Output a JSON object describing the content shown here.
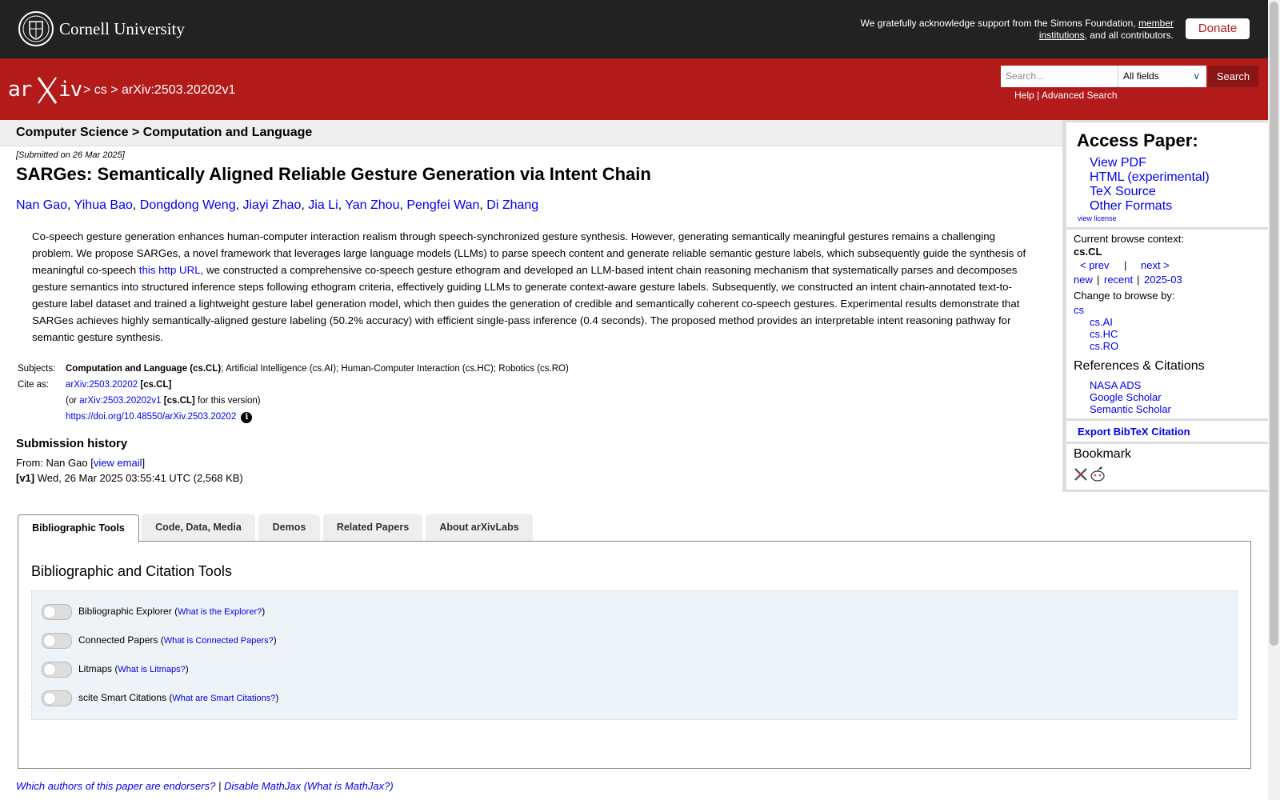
{
  "topbar": {
    "institution": "Cornell University",
    "support_prefix": "We gratefully acknowledge support from the Simons Foundation,",
    "support_link": "member institutions",
    "support_suffix": ", and all contributors.",
    "donate": "Donate"
  },
  "header": {
    "breadcrumb": "> cs > arXiv:2503.20202v1",
    "search_placeholder": "Search...",
    "search_field": "All fields",
    "search_button": "Search",
    "help": "Help",
    "sep": "|",
    "advanced": "Advanced Search"
  },
  "subheader": "Computer Science > Computation and Language",
  "paper": {
    "submitted": "[Submitted on 26 Mar 2025]",
    "title": "SARGes: Semantically Aligned Reliable Gesture Generation via Intent Chain",
    "authors": [
      "Nan Gao",
      "Yihua Bao",
      "Dongdong Weng",
      "Jiayi Zhao",
      "Jia Li",
      "Yan Zhou",
      "Pengfei Wan",
      "Di Zhang"
    ],
    "abstract_1": "Co-speech gesture generation enhances human-computer interaction realism through speech-synchronized gesture synthesis. However, generating semantically meaningful gestures remains a challenging problem. We propose SARGes, a novel framework that leverages large language models (LLMs) to parse speech content and generate reliable semantic gesture labels, which subsequently guide the synthesis of meaningful co-speech",
    "abstract_link": "this http URL",
    "abstract_2": ", we constructed a comprehensive co-speech gesture ethogram and developed an LLM-based intent chain reasoning mechanism that systematically parses and decomposes gesture semantics into structured inference steps following ethogram criteria, effectively guiding LLMs to generate context-aware gesture labels. Subsequently, we constructed an intent chain-annotated text-to-gesture label dataset and trained a lightweight gesture label generation model, which then guides the generation of credible and semantically coherent co-speech gestures. Experimental results demonstrate that SARGes achieves highly semantically-aligned gesture labeling (50.2% accuracy) with efficient single-pass inference (0.4 seconds). The proposed method provides an interpretable intent reasoning pathway for semantic gesture synthesis.",
    "subjects_label": "Subjects:",
    "subjects_primary": "Computation and Language (cs.CL)",
    "subjects_rest": "; Artificial Intelligence (cs.AI); Human-Computer Interaction (cs.HC); Robotics (cs.RO)",
    "cite_label": "Cite as:",
    "cite_id": "arXiv:2503.20202",
    "cite_cat": "[cs.CL]",
    "cite_or": "(or",
    "cite_version": "arXiv:2503.20202v1",
    "cite_cat2": "[cs.CL]",
    "cite_suffix": "for this version)",
    "doi": "https://doi.org/10.48550/arXiv.2503.20202",
    "history_title": "Submission history",
    "from": "From: Nan Gao [",
    "view_email": "view email",
    "from_close": "]",
    "v1_tag": "[v1]",
    "v1_text": "Wed, 26 Mar 2025 03:55:41 UTC (2,568 KB)"
  },
  "sidebar": {
    "access_title": "Access Paper:",
    "access_links": [
      "View PDF",
      "HTML (experimental)",
      "TeX Source",
      "Other Formats"
    ],
    "view_license": "view license",
    "browse_context": "Current browse context:",
    "context": "cs.CL",
    "prev": "< prev",
    "bar": "|",
    "next": "next >",
    "new": "new",
    "recent": "recent",
    "month": "2025-03",
    "change_browse": "Change to browse by:",
    "browse_cats": [
      "cs",
      "cs.AI",
      "cs.HC",
      "cs.RO"
    ],
    "refs_title": "References & Citations",
    "refs_links": [
      "NASA ADS",
      "Google Scholar",
      "Semantic Scholar"
    ],
    "export": "Export BibTeX Citation",
    "bookmark": "Bookmark"
  },
  "tabs": [
    "Bibliographic Tools",
    "Code, Data, Media",
    "Demos",
    "Related Papers",
    "About arXivLabs"
  ],
  "tools": {
    "title": "Bibliographic and Citation Tools",
    "items": [
      {
        "label": "Bibliographic Explorer",
        "link": "What is the Explorer?"
      },
      {
        "label": "Connected Papers",
        "link": "What is Connected Papers?"
      },
      {
        "label": "Litmaps",
        "link": "What is Litmaps?"
      },
      {
        "label": "scite Smart Citations",
        "link": "What are Smart Citations?"
      }
    ]
  },
  "footer": {
    "endorsers": "Which authors of this paper are endorsers?",
    "sep": "|",
    "disable": "Disable MathJax",
    "what": "(What is MathJax?)"
  }
}
